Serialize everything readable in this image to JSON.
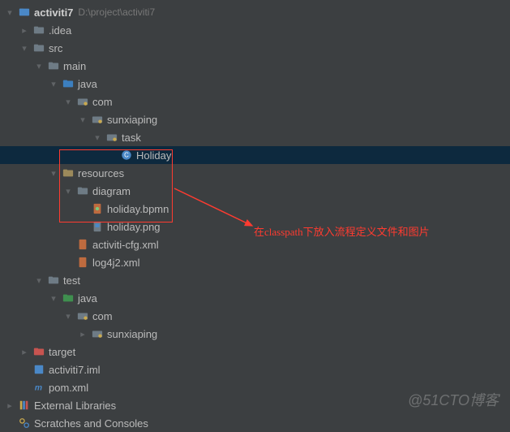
{
  "project": {
    "name": "activiti7",
    "path": "D:\\project\\activiti7"
  },
  "tree": {
    "idea": ".idea",
    "src": "src",
    "main": "main",
    "java": "java",
    "com": "com",
    "sunxiaping": "sunxiaping",
    "task": "task",
    "holiday_class": "Holiday",
    "resources": "resources",
    "diagram": "diagram",
    "holiday_bpmn": "holiday.bpmn",
    "holiday_png": "holiday.png",
    "activiti_cfg": "activiti-cfg.xml",
    "log4j2": "log4j2.xml",
    "test": "test",
    "java2": "java",
    "com2": "com",
    "sunxiaping2": "sunxiaping",
    "target": "target",
    "iml": "activiti7.iml",
    "pom": "pom.xml",
    "ext_lib": "External Libraries",
    "scratches": "Scratches and Consoles"
  },
  "annotation": "在classpath下放入流程定义文件和图片",
  "watermark": "@51CTO博客"
}
